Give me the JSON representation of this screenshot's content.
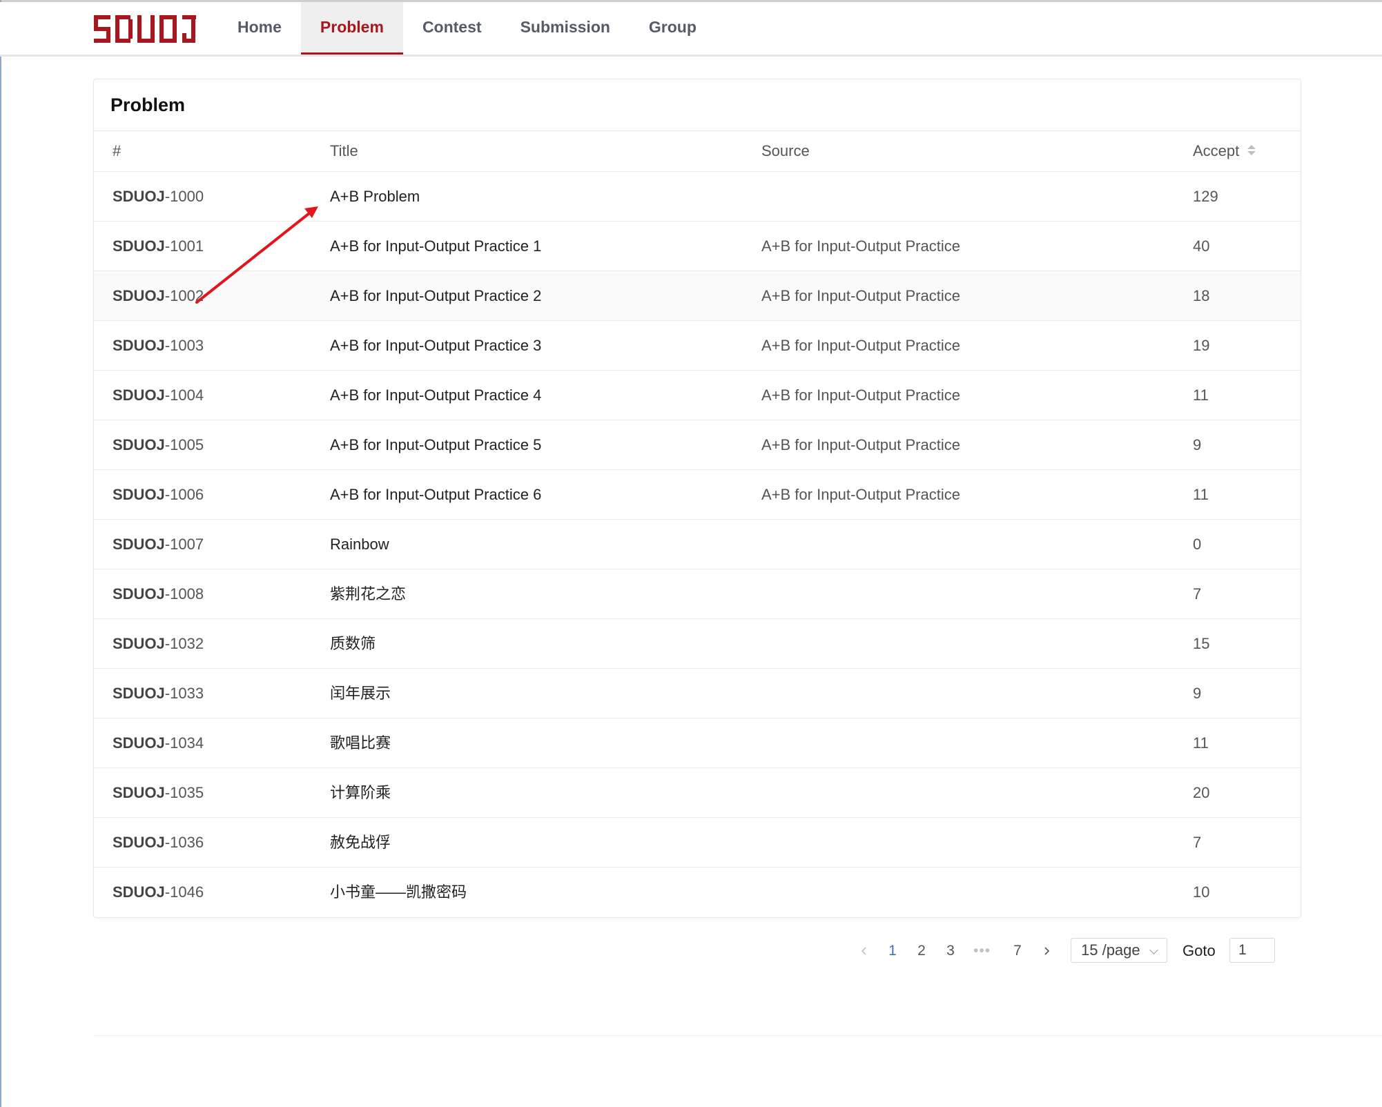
{
  "brand": {
    "logo_text": "SDUOJ",
    "color": "#a8161e"
  },
  "nav": [
    {
      "label": "Home",
      "active": false
    },
    {
      "label": "Problem",
      "active": true
    },
    {
      "label": "Contest",
      "active": false
    },
    {
      "label": "Submission",
      "active": false
    },
    {
      "label": "Group",
      "active": false
    }
  ],
  "card": {
    "title": "Problem",
    "columns": {
      "id": "#",
      "title": "Title",
      "source": "Source",
      "accept": "Accept"
    },
    "rows": [
      {
        "prefix": "SDUOJ",
        "num": "-1000",
        "title": "A+B Problem",
        "source": "",
        "accept": "129"
      },
      {
        "prefix": "SDUOJ",
        "num": "-1001",
        "title": "A+B for Input-Output Practice 1",
        "source": "A+B for Input-Output Practice",
        "accept": "40"
      },
      {
        "prefix": "SDUOJ",
        "num": "-1002",
        "title": "A+B for Input-Output Practice 2",
        "source": "A+B for Input-Output Practice",
        "accept": "18"
      },
      {
        "prefix": "SDUOJ",
        "num": "-1003",
        "title": "A+B for Input-Output Practice 3",
        "source": "A+B for Input-Output Practice",
        "accept": "19"
      },
      {
        "prefix": "SDUOJ",
        "num": "-1004",
        "title": "A+B for Input-Output Practice 4",
        "source": "A+B for Input-Output Practice",
        "accept": "11"
      },
      {
        "prefix": "SDUOJ",
        "num": "-1005",
        "title": "A+B for Input-Output Practice 5",
        "source": "A+B for Input-Output Practice",
        "accept": "9"
      },
      {
        "prefix": "SDUOJ",
        "num": "-1006",
        "title": "A+B for Input-Output Practice 6",
        "source": "A+B for Input-Output Practice",
        "accept": "11"
      },
      {
        "prefix": "SDUOJ",
        "num": "-1007",
        "title": "Rainbow",
        "source": "",
        "accept": "0"
      },
      {
        "prefix": "SDUOJ",
        "num": "-1008",
        "title": "紫荆花之恋",
        "source": "",
        "accept": "7"
      },
      {
        "prefix": "SDUOJ",
        "num": "-1032",
        "title": "质数筛",
        "source": "",
        "accept": "15"
      },
      {
        "prefix": "SDUOJ",
        "num": "-1033",
        "title": "闰年展示",
        "source": "",
        "accept": "9"
      },
      {
        "prefix": "SDUOJ",
        "num": "-1034",
        "title": "歌唱比赛",
        "source": "",
        "accept": "11"
      },
      {
        "prefix": "SDUOJ",
        "num": "-1035",
        "title": "计算阶乘",
        "source": "",
        "accept": "20"
      },
      {
        "prefix": "SDUOJ",
        "num": "-1036",
        "title": "赦免战俘",
        "source": "",
        "accept": "7"
      },
      {
        "prefix": "SDUOJ",
        "num": "-1046",
        "title": "小书童——凯撒密码",
        "source": "",
        "accept": "10"
      }
    ]
  },
  "pagination": {
    "pages": [
      "1",
      "2",
      "3",
      "•••",
      "7"
    ],
    "current_page": "1",
    "page_size_label": "15 /page",
    "goto_label": "Goto",
    "goto_value": "1"
  },
  "annotation": {
    "arrow_color": "#e0161e"
  }
}
